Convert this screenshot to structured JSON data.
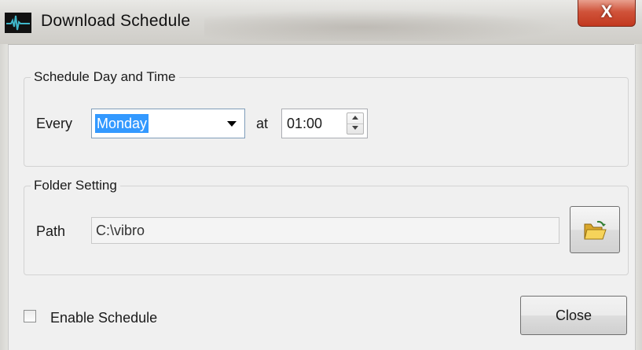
{
  "window": {
    "title": "Download Schedule",
    "close_glyph": "X",
    "app_icon": "waveform-icon"
  },
  "schedule_group": {
    "legend": "Schedule Day and Time",
    "every_label": "Every",
    "day_value": "Monday",
    "at_label": "at",
    "time_value": "01:00"
  },
  "folder_group": {
    "legend": "Folder Setting",
    "path_label": "Path",
    "path_value": "C:\\vibro",
    "browse_icon": "open-folder-icon"
  },
  "footer": {
    "enable_label": "Enable Schedule",
    "enable_checked": false,
    "close_label": "Close"
  },
  "colors": {
    "selection": "#3399ff",
    "close_button_red": "#c2391f",
    "dialog_bg": "#f0f0f0"
  }
}
